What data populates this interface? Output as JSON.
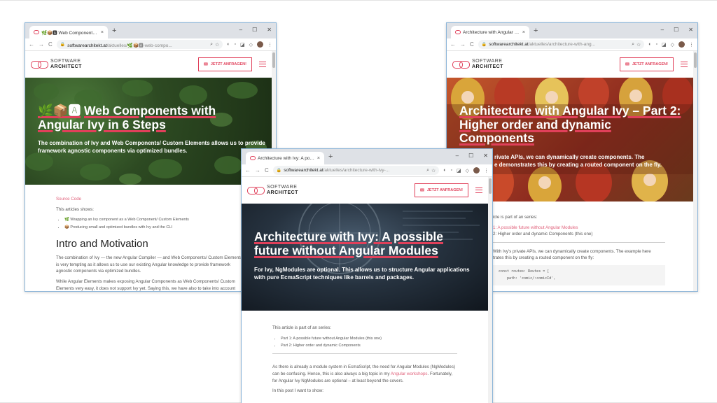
{
  "windows": {
    "left": {
      "tab_title": "🌿📦🅰 Web Components with",
      "tab_close": "×",
      "url_host": "softwarearchitekt.at",
      "url_path": "/aktuelles/🌿📦🅰-web-compo...",
      "hero_emoji": "🌿📦🅰",
      "hero_title": "Web Components with Angular Ivy in 6 Steps",
      "hero_subtitle": "The combination of Ivy and Web Components/ Custom Elements allows us to provide framework agnostic components via optimized bundles.",
      "source_link": "Source Code",
      "intro_line": "This articles shows:",
      "bullets": [
        "🌿 Wrapping an Ivy component as a Web Component/ Custom Elements",
        "📦 Producing small and optimized bundles with Ivy and the CLI"
      ],
      "heading": "Intro and Motivation",
      "para1": "The combination of Ivy — the new Angular Compiler — and Web Components/ Custom Elements is very tempting as it allows us to use our existing Angular knowledge to provide framework agnostic components via optimized bundles.",
      "para2": "While Angular Elements makes exposing Angular Components as Web Components/ Custom Elements very easy, it does not support Ivy yet. Saying this, we have also to take into account that Ivy is currently in a quite early stage. Regarding this, I also like to point out"
    },
    "right": {
      "tab_title": "Architecture with Angular Ivy – P",
      "tab_close": "×",
      "url_host": "softwarearchitekt.at",
      "url_path": "/aktuelles/architecture-with-ang...",
      "hero_title": "Architecture with Angular Ivy – Part 2: Higher order and dynamic Components",
      "hero_sub_line1": "rivate APIs, we can dynamically create components. The",
      "hero_sub_line2": "e demonstrates this by creating a routed component on the fly.",
      "series_intro": "icle is part of an series:",
      "series": [
        "1: A possible future without Angular Modules",
        "2: Higher order and dynamic Components (this one)"
      ],
      "para1": "With Ivy's private APIs, we can dynamically create components. The example here",
      "para2": "trates this by creating a routed component on the fly:",
      "code1": "const routes: Routes = [",
      "code2": "path: 'comic/:comicId',"
    },
    "center": {
      "tab_title": "Architecture with Ivy: A possibl",
      "tab_close": "×",
      "url_host": "softwarearchitekt.at",
      "url_path": "/aktuelles/architecture-with-ivy-...",
      "hero_title": "Architecture with Ivy: A possible future without Angular Modules",
      "hero_subtitle": "For Ivy, NgModules are optional. This allows us to structure Angular applications with pure EcmaScript techniques like barrels and packages.",
      "series_intro": "This article is part of an series:",
      "series": [
        "Part 1: A possible future without Angular Modules (this one)",
        "Part 2: Higher order and dynamic Components"
      ],
      "para1_a": "As there is already a module system in EcmaScript, the need for Angular Modules (NgModules) can be confusing. Hence, this is also always a big topic in my ",
      "para1_link": "Angular workshops",
      "para1_b": ". Fortunately, for Angular Ivy NgModules are optional – at least beyond the covers.",
      "para2": "In this post I want to show:"
    }
  },
  "site": {
    "logo_line1": "SOFTWARE",
    "logo_line2": "ARCHITECT",
    "cta": "JETZT ANFRAGEN!"
  },
  "browser": {
    "new_tab": "+",
    "minimize": "–",
    "maximize": "☐",
    "close": "✕",
    "back": "←",
    "forward": "→",
    "reload": "C",
    "lock": "🔒"
  },
  "colors": {
    "accent": "#e0405a",
    "hero_left": "#2d4a22",
    "hero_right": "#b0452a",
    "hero_center": "#1e2a36"
  }
}
